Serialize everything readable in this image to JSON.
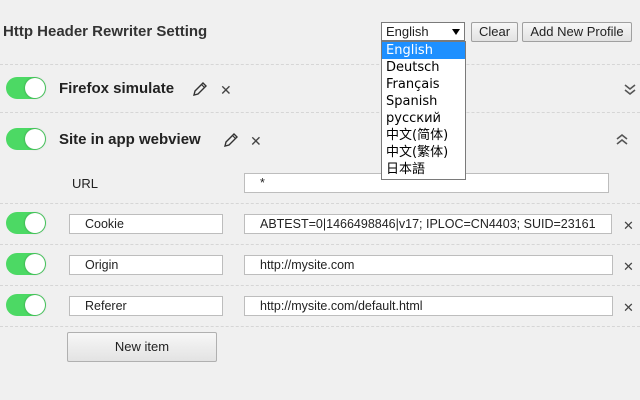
{
  "header": {
    "title": "Http Header Rewriter Setting",
    "language_selected": "English",
    "clear_label": "Clear",
    "add_profile_label": "Add New Profile"
  },
  "language_dropdown": {
    "options": [
      "English",
      "Deutsch",
      "Français",
      "Spanish",
      "русский",
      "中文(简体)",
      "中文(繁体)",
      "日本語"
    ],
    "selected_index": 0
  },
  "profiles": [
    {
      "name": "Firefox simulate",
      "enabled": true,
      "expanded": false
    },
    {
      "name": "Site in app webview",
      "enabled": true,
      "expanded": true
    }
  ],
  "profile_detail": {
    "url_label": "URL",
    "url_value": "*",
    "headers": [
      {
        "name": "Cookie",
        "value": "ABTEST=0|1466498846|v17; IPLOC=CN4403; SUID=23161",
        "enabled": true
      },
      {
        "name": "Origin",
        "value": "http://mysite.com",
        "enabled": true
      },
      {
        "name": "Referer",
        "value": "http://mysite.com/default.html",
        "enabled": true
      }
    ],
    "new_item_label": "New item"
  },
  "icons": {
    "edit": "pencil-icon",
    "delete": "close-icon",
    "expand": "chevron-double-down-icon",
    "collapse": "chevron-double-up-icon"
  },
  "colors": {
    "toggle_on": "#4cd964",
    "selected_option": "#1e90ff"
  }
}
